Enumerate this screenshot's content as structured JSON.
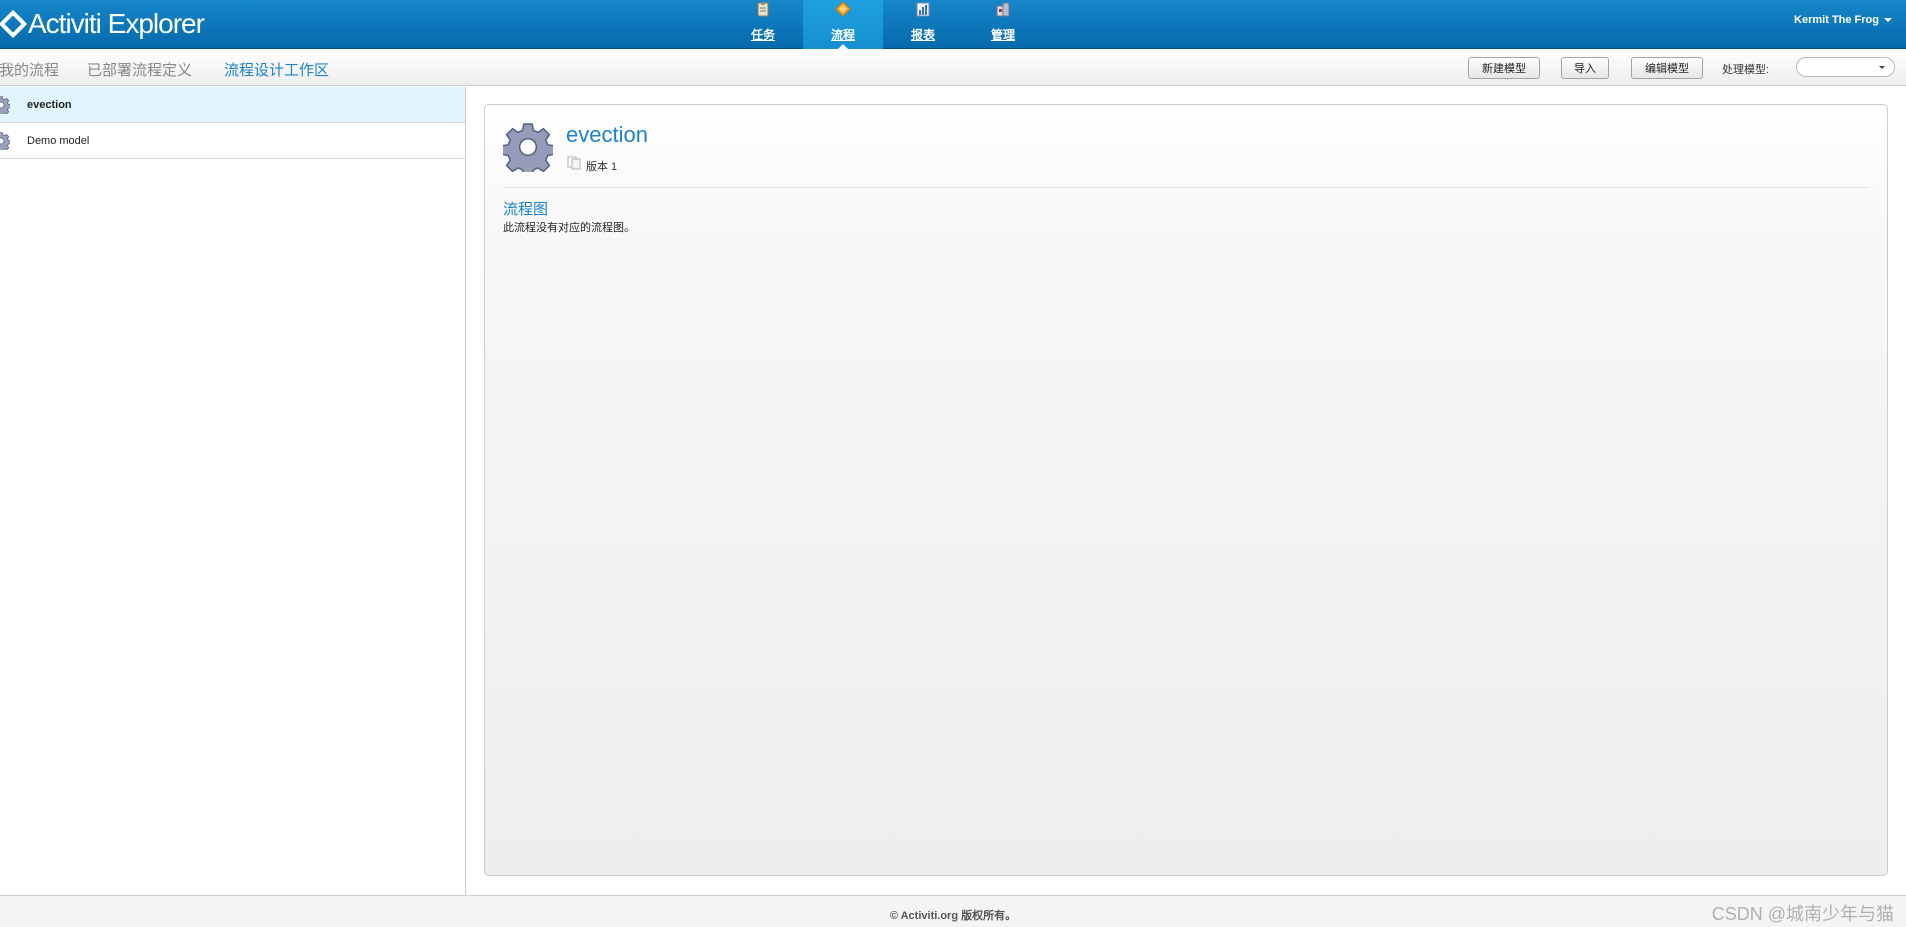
{
  "header": {
    "logo_text": "Activiti Explorer",
    "user": "Kermit The Frog",
    "nav": [
      {
        "label": "任务",
        "icon": "clipboard-icon"
      },
      {
        "label": "流程",
        "icon": "process-diamond-icon",
        "active": true
      },
      {
        "label": "报表",
        "icon": "chart-icon"
      },
      {
        "label": "管理",
        "icon": "admin-icon"
      }
    ]
  },
  "toolbar": {
    "tabs": [
      "我的流程",
      "已部署流程定义",
      "流程设计工作区"
    ],
    "active_tab": "流程设计工作区",
    "buttons": [
      "新建模型",
      "导入",
      "编辑模型"
    ],
    "process_label": "处理模型:",
    "process_value": ""
  },
  "models": [
    {
      "name": "evection",
      "selected": true,
      "icon": "gear-icon"
    },
    {
      "name": "Demo model",
      "selected": false,
      "icon": "gear-icon"
    }
  ],
  "detail": {
    "title": "evection",
    "version": "版本 1",
    "section_title": "流程图",
    "section_text": "此流程没有对应的流程图。"
  },
  "footer": {
    "copyright": "© Activiti.org 版权所有。",
    "watermark": "CSDN @城南少年与猫"
  },
  "colors": {
    "header": "#0b78bd",
    "accent": "#1b83c7",
    "selected_row": "#e0f5fd"
  }
}
